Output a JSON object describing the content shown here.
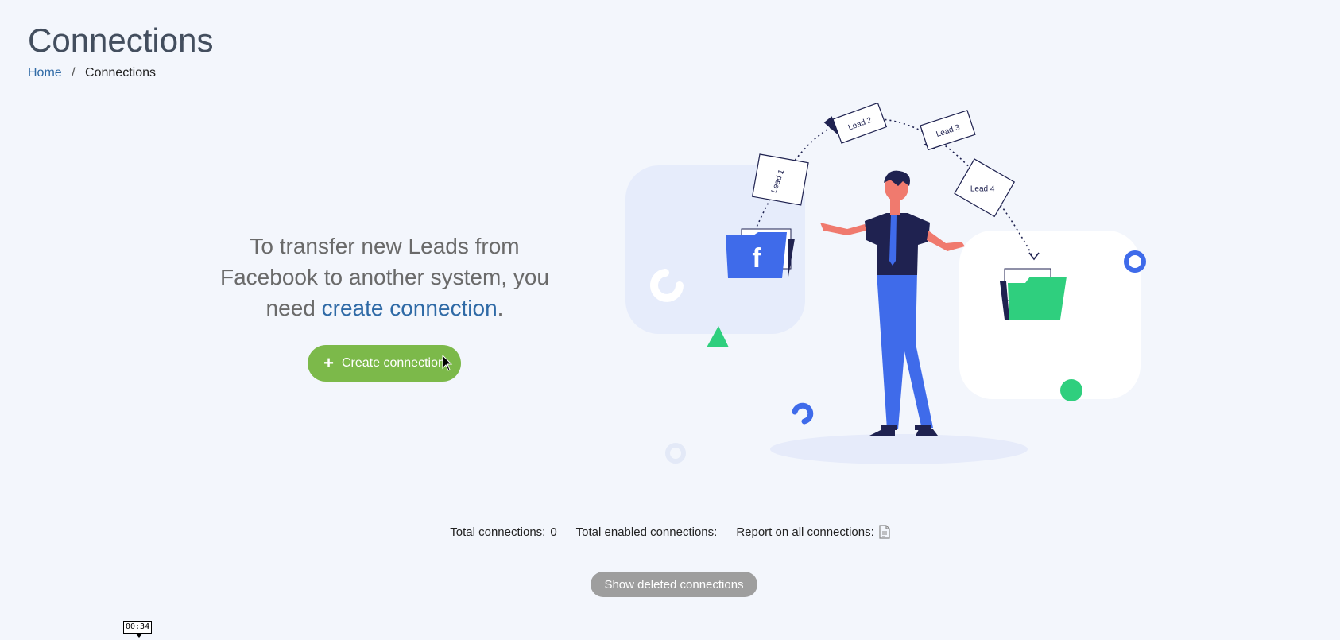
{
  "page": {
    "title": "Connections"
  },
  "breadcrumb": {
    "home": "Home",
    "separator": "/",
    "current": "Connections"
  },
  "intro": {
    "text_before": "To transfer new Leads from Facebook to another system, you need ",
    "link": "create connection",
    "text_after": "."
  },
  "create_button": {
    "label": "Create connection",
    "icon": "plus-icon"
  },
  "illustration": {
    "leads": [
      "Lead 1",
      "Lead 2",
      "Lead 3",
      "Lead 4"
    ],
    "source_icon": "facebook-folder-icon",
    "target_icon": "green-folder-icon"
  },
  "stats": {
    "total_label": "Total connections:",
    "total_value": "0",
    "enabled_label": "Total enabled connections:",
    "report_label": "Report on all connections:",
    "report_icon": "document-icon"
  },
  "deleted_button": {
    "label": "Show deleted connections"
  },
  "overlay": {
    "timer": "00:34"
  },
  "colors": {
    "background": "#f3f6fc",
    "link": "#2f6aa6",
    "create_button": "#7cb94a",
    "deleted_button": "#9e9e9e",
    "facebook_blue": "#3f6bea",
    "green_folder": "#2fcf7e",
    "navy": "#1f2250"
  }
}
